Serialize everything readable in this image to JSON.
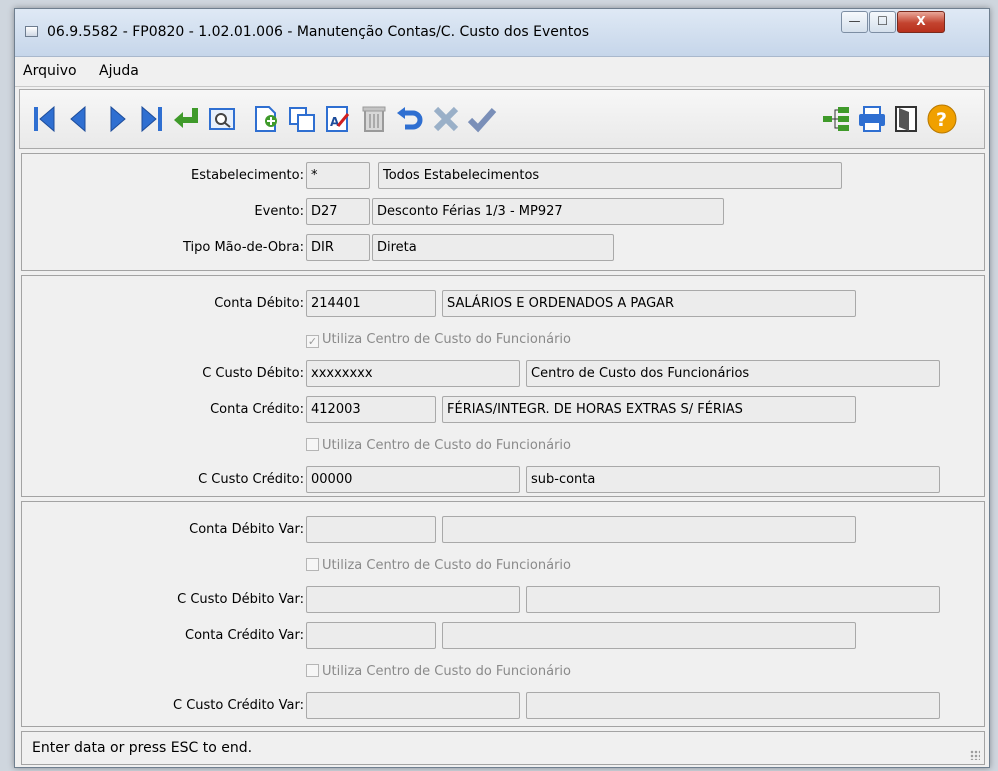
{
  "window": {
    "title": "06.9.5582 - FP0820 - 1.02.01.006 - Manutenção Contas/C. Custo dos Eventos",
    "minimize_label": "—",
    "maximize_label": "☐",
    "close_label": "X"
  },
  "menu": {
    "file": "Arquivo",
    "help": "Ajuda"
  },
  "toolbar": {
    "icons": [
      "first-record-icon",
      "previous-record-icon",
      "next-record-icon",
      "last-record-icon",
      "return-icon",
      "search-icon",
      "new-record-icon",
      "copy-record-icon",
      "edit-record-icon",
      "delete-record-icon",
      "undo-icon",
      "cancel-icon",
      "save-icon",
      "tree-icon",
      "print-icon",
      "exit-icon",
      "help-icon"
    ],
    "help_label": "?"
  },
  "header": {
    "estabelecimento": {
      "label": "Estabelecimento:",
      "code": "*",
      "desc": "Todos Estabelecimentos"
    },
    "evento": {
      "label": "Evento:",
      "code": "D27",
      "desc": "Desconto Férias 1/3 - MP927"
    },
    "tipo_mao_obra": {
      "label": "Tipo Mão-de-Obra:",
      "code": "DIR",
      "desc": "Direta"
    }
  },
  "accounts": {
    "conta_debito": {
      "label": "Conta Débito:",
      "code": "214401",
      "desc": "SALÁRIOS E ORDENADOS A PAGAR"
    },
    "utiliza_cc_debito": {
      "label": "Utiliza Centro de Custo do Funcionário",
      "checked": true,
      "mark": "✓"
    },
    "cc_debito": {
      "label": "C Custo Débito:",
      "code": "xxxxxxxx",
      "desc": "Centro de Custo dos Funcionários"
    },
    "conta_credito": {
      "label": "Conta Crédito:",
      "code": "412003",
      "desc": "FÉRIAS/INTEGR. DE HORAS EXTRAS S/ FÉRIAS"
    },
    "utiliza_cc_credito": {
      "label": "Utiliza Centro de Custo do Funcionário",
      "checked": false
    },
    "cc_credito": {
      "label": "C Custo Crédito:",
      "code": "00000",
      "desc": "sub-conta"
    }
  },
  "variable": {
    "conta_debito_var": {
      "label": "Conta Débito Var:",
      "code": "",
      "desc": ""
    },
    "utiliza_cc_debito_var": {
      "label": "Utiliza Centro de Custo do Funcionário",
      "checked": false
    },
    "cc_debito_var": {
      "label": "C Custo Débito Var:",
      "code": "",
      "desc": ""
    },
    "conta_credito_var": {
      "label": "Conta Crédito Var:",
      "code": "",
      "desc": ""
    },
    "utiliza_cc_credito_var": {
      "label": "Utiliza Centro de Custo do Funcionário",
      "checked": false
    },
    "cc_credito_var": {
      "label": "C Custo Crédito Var:",
      "code": "",
      "desc": ""
    }
  },
  "status": {
    "text": "Enter data or press ESC to end."
  },
  "colors": {
    "nav_blue": "#2f6fd1",
    "green": "#3f9a2a",
    "help_orange": "#f0a000"
  }
}
